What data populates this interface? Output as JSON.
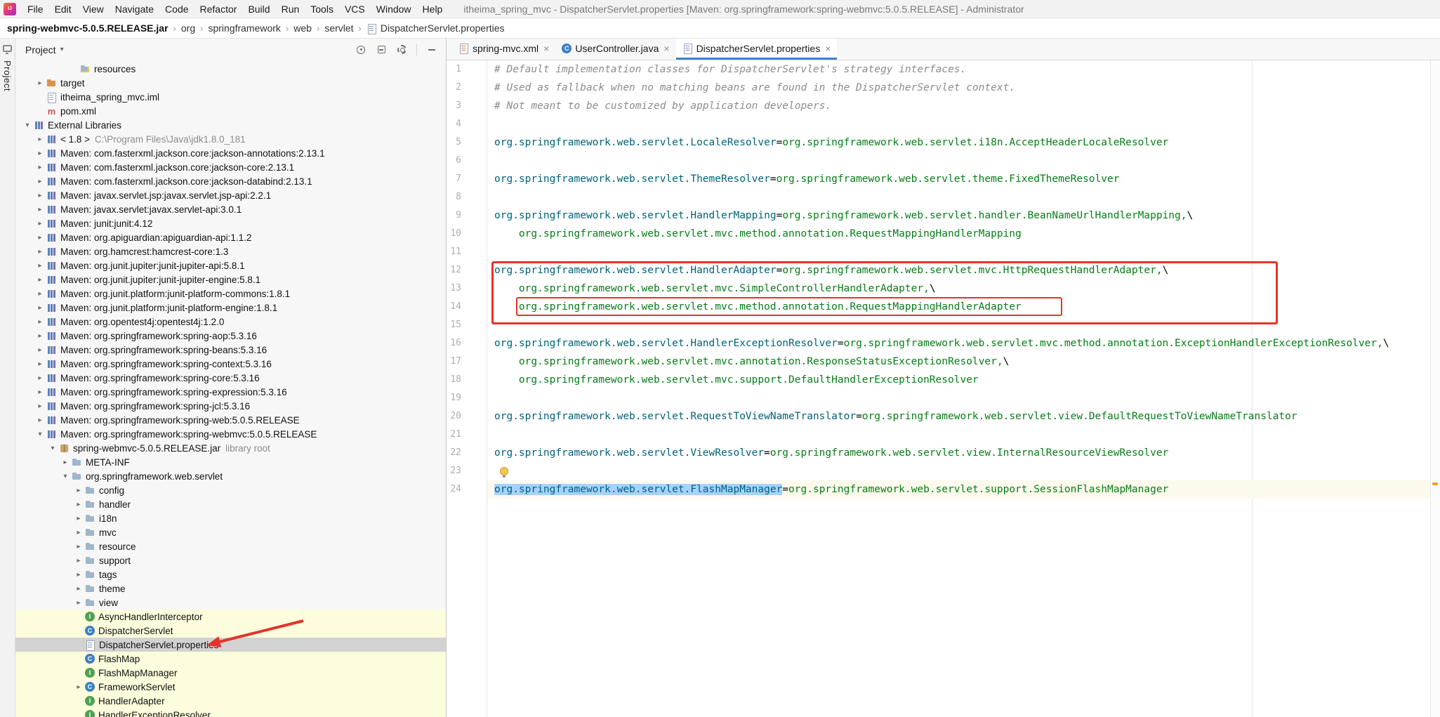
{
  "window": {
    "title": "itheima_spring_mvc - DispatcherServlet.properties [Maven: org.springframework:spring-webmvc:5.0.5.RELEASE] - Administrator",
    "logo_text": "IJ"
  },
  "menu": {
    "items": [
      "File",
      "Edit",
      "View",
      "Navigate",
      "Code",
      "Refactor",
      "Build",
      "Run",
      "Tools",
      "VCS",
      "Window",
      "Help"
    ]
  },
  "breadcrumbs": {
    "separator": "›",
    "items": [
      "spring-webmvc-5.0.5.RELEASE.jar",
      "org",
      "springframework",
      "web",
      "servlet",
      "DispatcherServlet.properties"
    ]
  },
  "tool_strip": {
    "label": "Project"
  },
  "project_panel": {
    "title": "Project",
    "chevron": "▾"
  },
  "icons": {
    "chevron_collapsed": "▸",
    "chevron_expanded": "▾",
    "close": "×",
    "class_letter": "C",
    "interface_letter": "I",
    "maven_letter": "m"
  },
  "tree": {
    "items": [
      {
        "label": "resources",
        "icon": "folder-res",
        "indent": 74
      },
      {
        "label": "target",
        "icon": "folder-excl",
        "indent": 26,
        "arrow": "c"
      },
      {
        "label": "itheima_spring_mvc.iml",
        "icon": "file",
        "indent": 26
      },
      {
        "label": "pom.xml",
        "icon": "maven",
        "indent": 26
      },
      {
        "label": "External Libraries",
        "icon": "lib",
        "indent": 8,
        "arrow": "e"
      },
      {
        "label": "< 1.8 >",
        "suffix": "C:\\Program Files\\Java\\jdk1.8.0_181",
        "icon": "lib",
        "indent": 26,
        "arrow": "c"
      },
      {
        "label": "Maven: com.fasterxml.jackson.core:jackson-annotations:2.13.1",
        "icon": "lib",
        "indent": 26,
        "arrow": "c"
      },
      {
        "label": "Maven: com.fasterxml.jackson.core:jackson-core:2.13.1",
        "icon": "lib",
        "indent": 26,
        "arrow": "c"
      },
      {
        "label": "Maven: com.fasterxml.jackson.core:jackson-databind:2.13.1",
        "icon": "lib",
        "indent": 26,
        "arrow": "c"
      },
      {
        "label": "Maven: javax.servlet.jsp:javax.servlet.jsp-api:2.2.1",
        "icon": "lib",
        "indent": 26,
        "arrow": "c"
      },
      {
        "label": "Maven: javax.servlet:javax.servlet-api:3.0.1",
        "icon": "lib",
        "indent": 26,
        "arrow": "c"
      },
      {
        "label": "Maven: junit:junit:4.12",
        "icon": "lib",
        "indent": 26,
        "arrow": "c"
      },
      {
        "label": "Maven: org.apiguardian:apiguardian-api:1.1.2",
        "icon": "lib",
        "indent": 26,
        "arrow": "c"
      },
      {
        "label": "Maven: org.hamcrest:hamcrest-core:1.3",
        "icon": "lib",
        "indent": 26,
        "arrow": "c"
      },
      {
        "label": "Maven: org.junit.jupiter:junit-jupiter-api:5.8.1",
        "icon": "lib",
        "indent": 26,
        "arrow": "c"
      },
      {
        "label": "Maven: org.junit.jupiter:junit-jupiter-engine:5.8.1",
        "icon": "lib",
        "indent": 26,
        "arrow": "c"
      },
      {
        "label": "Maven: org.junit.platform:junit-platform-commons:1.8.1",
        "icon": "lib",
        "indent": 26,
        "arrow": "c"
      },
      {
        "label": "Maven: org.junit.platform:junit-platform-engine:1.8.1",
        "icon": "lib",
        "indent": 26,
        "arrow": "c"
      },
      {
        "label": "Maven: org.opentest4j:opentest4j:1.2.0",
        "icon": "lib",
        "indent": 26,
        "arrow": "c"
      },
      {
        "label": "Maven: org.springframework:spring-aop:5.3.16",
        "icon": "lib",
        "indent": 26,
        "arrow": "c"
      },
      {
        "label": "Maven: org.springframework:spring-beans:5.3.16",
        "icon": "lib",
        "indent": 26,
        "arrow": "c"
      },
      {
        "label": "Maven: org.springframework:spring-context:5.3.16",
        "icon": "lib",
        "indent": 26,
        "arrow": "c"
      },
      {
        "label": "Maven: org.springframework:spring-core:5.3.16",
        "icon": "lib",
        "indent": 26,
        "arrow": "c"
      },
      {
        "label": "Maven: org.springframework:spring-expression:5.3.16",
        "icon": "lib",
        "indent": 26,
        "arrow": "c"
      },
      {
        "label": "Maven: org.springframework:spring-jcl:5.3.16",
        "icon": "lib",
        "indent": 26,
        "arrow": "c"
      },
      {
        "label": "Maven: org.springframework:spring-web:5.0.5.RELEASE",
        "icon": "lib",
        "indent": 26,
        "arrow": "c"
      },
      {
        "label": "Maven: org.springframework:spring-webmvc:5.0.5.RELEASE",
        "icon": "lib",
        "indent": 26,
        "arrow": "e"
      },
      {
        "label": "spring-webmvc-5.0.5.RELEASE.jar",
        "suffix": "library root",
        "icon": "jar",
        "indent": 44,
        "arrow": "e"
      },
      {
        "label": "META-INF",
        "icon": "folder",
        "indent": 62,
        "arrow": "c"
      },
      {
        "label": "org.springframework.web.servlet",
        "icon": "folder",
        "indent": 62,
        "arrow": "e"
      },
      {
        "label": "config",
        "icon": "folder",
        "indent": 81,
        "arrow": "c"
      },
      {
        "label": "handler",
        "icon": "folder",
        "indent": 81,
        "arrow": "c"
      },
      {
        "label": "i18n",
        "icon": "folder",
        "indent": 81,
        "arrow": "c"
      },
      {
        "label": "mvc",
        "icon": "folder",
        "indent": 81,
        "arrow": "c"
      },
      {
        "label": "resource",
        "icon": "folder",
        "indent": 81,
        "arrow": "c"
      },
      {
        "label": "support",
        "icon": "folder",
        "indent": 81,
        "arrow": "c"
      },
      {
        "label": "tags",
        "icon": "folder",
        "indent": 81,
        "arrow": "c"
      },
      {
        "label": "theme",
        "icon": "folder",
        "indent": 81,
        "arrow": "c"
      },
      {
        "label": "view",
        "icon": "folder",
        "indent": 81,
        "arrow": "c"
      },
      {
        "label": "AsyncHandlerInterceptor",
        "icon": "interface",
        "indent": 81,
        "bg": "cream"
      },
      {
        "label": "DispatcherServlet",
        "icon": "class",
        "indent": 81,
        "bg": "cream"
      },
      {
        "label": "DispatcherServlet.properties",
        "icon": "properties",
        "indent": 81,
        "bg": "cream",
        "selected": true
      },
      {
        "label": "FlashMap",
        "icon": "class",
        "indent": 81,
        "bg": "cream"
      },
      {
        "label": "FlashMapManager",
        "icon": "interface",
        "indent": 81,
        "bg": "cream"
      },
      {
        "label": "FrameworkServlet",
        "icon": "class",
        "indent": 81,
        "arrow": "c",
        "bg": "cream"
      },
      {
        "label": "HandlerAdapter",
        "icon": "interface",
        "indent": 81,
        "bg": "cream"
      },
      {
        "label": "HandlerExceptionResolver",
        "icon": "interface",
        "indent": 81,
        "bg": "cream"
      }
    ]
  },
  "tabs": {
    "items": [
      {
        "label": "spring-mvc.xml",
        "icon": "xml"
      },
      {
        "label": "UserController.java",
        "icon": "class"
      },
      {
        "label": "DispatcherServlet.properties",
        "icon": "properties",
        "active": true
      }
    ]
  },
  "editor": {
    "lines": [
      {
        "seg": [
          [
            "c",
            "# Default implementation classes for DispatcherServlet's strategy interfaces."
          ]
        ]
      },
      {
        "seg": [
          [
            "c",
            "# Used as fallback when no matching beans are found in the DispatcherServlet context."
          ]
        ]
      },
      {
        "seg": [
          [
            "c",
            "# Not meant to be customized by application developers."
          ]
        ]
      },
      {
        "seg": []
      },
      {
        "seg": [
          [
            "k",
            "org.springframework.web.servlet.LocaleResolver"
          ],
          [
            "eq",
            "="
          ],
          [
            "v",
            "org.springframework.web.servlet.i18n.AcceptHeaderLocaleResolver"
          ]
        ]
      },
      {
        "seg": []
      },
      {
        "seg": [
          [
            "k",
            "org.springframework.web.servlet.ThemeResolver"
          ],
          [
            "eq",
            "="
          ],
          [
            "v",
            "org.springframework.web.servlet.theme.FixedThemeResolver"
          ]
        ]
      },
      {
        "seg": []
      },
      {
        "seg": [
          [
            "k",
            "org.springframework.web.servlet.HandlerMapping"
          ],
          [
            "eq",
            "="
          ],
          [
            "v",
            "org.springframework.web.servlet.handler.BeanNameUrlHandlerMapping,"
          ],
          [
            "b",
            "\\"
          ]
        ]
      },
      {
        "seg": [
          [
            "v",
            "    org.springframework.web.servlet.mvc.method.annotation.RequestMappingHandlerMapping"
          ]
        ]
      },
      {
        "seg": []
      },
      {
        "seg": [
          [
            "k",
            "org.springframework.web.servlet.HandlerAdapter"
          ],
          [
            "eq",
            "="
          ],
          [
            "v",
            "org.springframework.web.servlet.mvc.HttpRequestHandlerAdapter,"
          ],
          [
            "b",
            "\\"
          ]
        ]
      },
      {
        "seg": [
          [
            "v",
            "    org.springframework.web.servlet.mvc.SimpleControllerHandlerAdapter,"
          ],
          [
            "b",
            "\\"
          ]
        ]
      },
      {
        "seg": [
          [
            "v",
            "    org.springframework.web.servlet.mvc.method.annotation.RequestMappingHandlerAdapter"
          ]
        ]
      },
      {
        "seg": []
      },
      {
        "seg": [
          [
            "k",
            "org.springframework.web.servlet.HandlerExceptionResolver"
          ],
          [
            "eq",
            "="
          ],
          [
            "v",
            "org.springframework.web.servlet.mvc.method.annotation.ExceptionHandlerExceptionResolver,"
          ],
          [
            "b",
            "\\"
          ]
        ]
      },
      {
        "seg": [
          [
            "v",
            "    org.springframework.web.servlet.mvc.annotation.ResponseStatusExceptionResolver,"
          ],
          [
            "b",
            "\\"
          ]
        ]
      },
      {
        "seg": [
          [
            "v",
            "    org.springframework.web.servlet.mvc.support.DefaultHandlerExceptionResolver"
          ]
        ]
      },
      {
        "seg": []
      },
      {
        "seg": [
          [
            "k",
            "org.springframework.web.servlet.RequestToViewNameTranslator"
          ],
          [
            "eq",
            "="
          ],
          [
            "v",
            "org.springframework.web.servlet.view.DefaultRequestToViewNameTranslator"
          ]
        ]
      },
      {
        "seg": []
      },
      {
        "seg": [
          [
            "k",
            "org.springframework.web.servlet.ViewResolver"
          ],
          [
            "eq",
            "="
          ],
          [
            "v",
            "org.springframework.web.servlet.view.InternalResourceViewResolver"
          ]
        ]
      },
      {
        "seg": [],
        "bulb": true
      },
      {
        "seg": [
          [
            "ks",
            "org.springframework.web.servlet.FlashMapManager"
          ],
          [
            "eq",
            "="
          ],
          [
            "v",
            "org.springframework.web.servlet.support.SessionFlashMapManager"
          ]
        ],
        "current": true
      }
    ]
  },
  "annotation_colors": {
    "red": "#E3342C"
  }
}
